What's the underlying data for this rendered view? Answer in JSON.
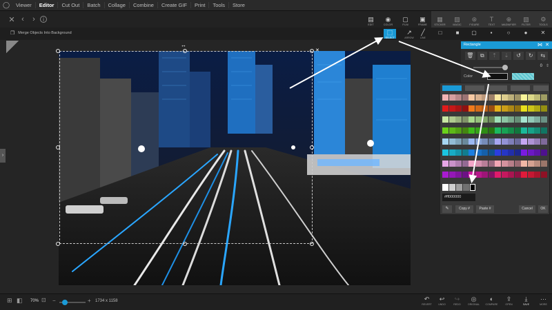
{
  "menu": {
    "items": [
      "Viewer",
      "Editor",
      "Cut Out",
      "Batch",
      "Collage",
      "Combine",
      "Create GIF",
      "Print",
      "Tools",
      "Store"
    ],
    "active": "Editor"
  },
  "top_tools": [
    {
      "label": "EDIT",
      "icon": "edit-icon"
    },
    {
      "label": "COLOR",
      "icon": "color-icon"
    },
    {
      "label": "FILM",
      "icon": "film-icon"
    },
    {
      "label": "FRAME",
      "icon": "frame-icon"
    },
    {
      "label": "STICKER",
      "icon": "sticker-icon"
    },
    {
      "label": "MAGIC",
      "icon": "magic-icon"
    },
    {
      "label": "FIGURE",
      "icon": "figure-icon"
    },
    {
      "label": "TEXT",
      "icon": "text-icon"
    },
    {
      "label": "MAGNIFIER",
      "icon": "magnifier-icon"
    },
    {
      "label": "FILTER",
      "icon": "filter-icon"
    },
    {
      "label": "TOOLS",
      "icon": "tools-icon"
    }
  ],
  "subbar": {
    "merge_label": "Merge Objects Into Background"
  },
  "shape_tools": [
    {
      "label": "SELECT",
      "selected": true
    },
    {
      "label": "ARROW"
    },
    {
      "label": "LINE"
    }
  ],
  "panel": {
    "title": "Rectangle",
    "opacity_value": "0",
    "color_label": "Color",
    "accent_color": "#1a9ad6"
  },
  "color_picker": {
    "hex_value": "#ff000000",
    "copy_label": "Copy #",
    "paste_label": "Paste #",
    "cancel_label": "Cancel",
    "ok_label": "OK"
  },
  "status": {
    "zoom": "70%",
    "dimensions": "1734 x 1158"
  },
  "bottom_tools": [
    {
      "label": "REVERT",
      "dim": false
    },
    {
      "label": "UNDO",
      "dim": false
    },
    {
      "label": "REDO",
      "dim": true
    },
    {
      "label": "ORIGINAL",
      "dim": false
    },
    {
      "label": "COMPARE",
      "dim": false
    },
    {
      "label": "OPEN",
      "dim": false
    },
    {
      "label": "SAVE",
      "dim": false
    },
    {
      "label": "MORE",
      "dim": false
    }
  ]
}
